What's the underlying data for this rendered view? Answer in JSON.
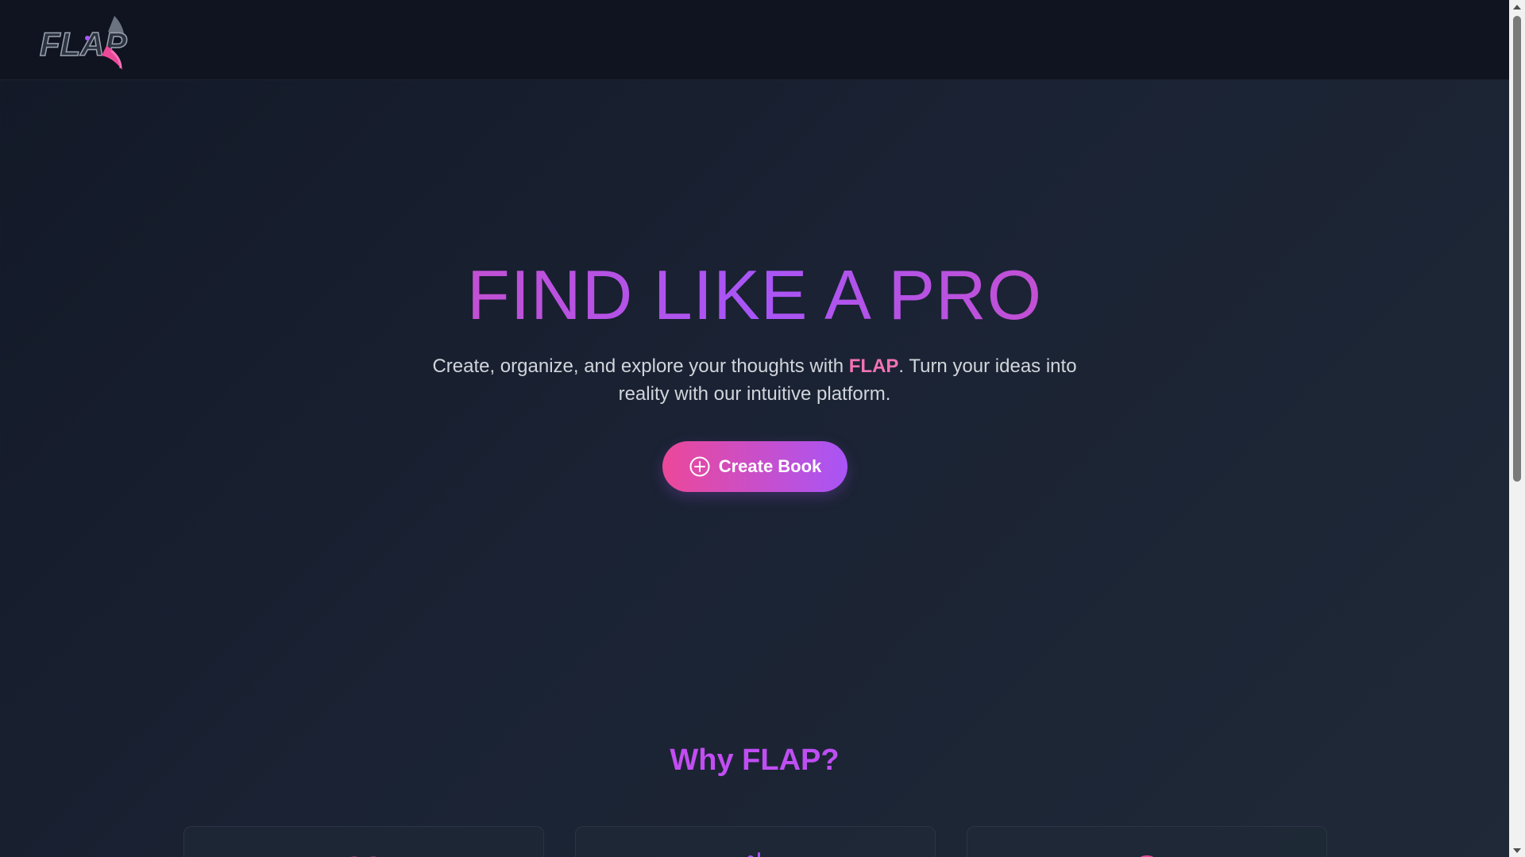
{
  "brand": {
    "logo_text": "FLAP",
    "logo_icon": "flap-feather-logo"
  },
  "hero": {
    "title": "FIND LIKE A PRO",
    "subtitle_before": "Create, organize, and explore your thoughts with ",
    "subtitle_brand": "FLAP",
    "subtitle_after": ". Turn your ideas into reality with our intuitive platform.",
    "cta_label": "Create Book",
    "cta_icon": "plus-circle-icon"
  },
  "features": {
    "title": "Why FLAP?",
    "cards": [
      {
        "icon": "book-open-icon"
      },
      {
        "icon": "users-icon"
      },
      {
        "icon": "lightbulb-icon"
      }
    ]
  },
  "colors": {
    "background": "#1a2233",
    "navbar": "#0f1420",
    "accent_pink": "#ec4899",
    "accent_purple": "#a855f7",
    "brand_highlight": "#f472b6",
    "body_text": "#d1d5db"
  }
}
